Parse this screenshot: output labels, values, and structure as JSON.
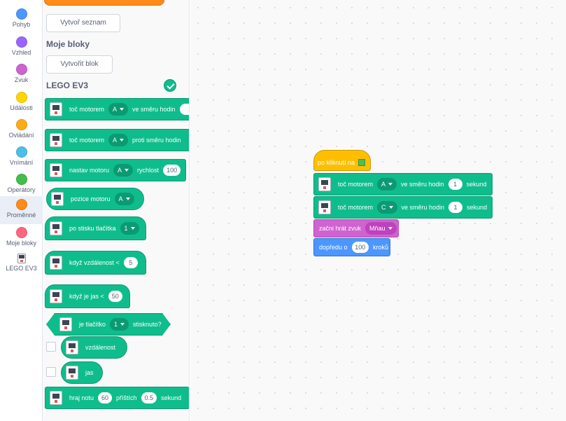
{
  "categories": [
    {
      "label": "Pohyb",
      "color": "#4c97ff",
      "icon": "motion-dot-icon"
    },
    {
      "label": "Vzhled",
      "color": "#9966ff",
      "icon": "looks-dot-icon"
    },
    {
      "label": "Zvuk",
      "color": "#cf63cf",
      "icon": "sound-dot-icon"
    },
    {
      "label": "Události",
      "color": "#ffd500",
      "icon": "events-dot-icon"
    },
    {
      "label": "Ovládání",
      "color": "#ffab19",
      "icon": "control-dot-icon"
    },
    {
      "label": "Vnímání",
      "color": "#4cbfe6",
      "icon": "sensing-dot-icon"
    },
    {
      "label": "Operátory",
      "color": "#40bf4a",
      "icon": "operators-dot-icon"
    },
    {
      "label": "Proměnné",
      "color": "#ff8c1a",
      "icon": "variables-dot-icon"
    },
    {
      "label": "Moje bloky",
      "color": "#ff6680",
      "icon": "myblocks-dot-icon"
    },
    {
      "label": "LEGO EV3",
      "color": "#0fbd8c",
      "icon": "ev3-brick-icon"
    }
  ],
  "palette": {
    "make_list": "Vytvoř seznam",
    "my_blocks_heading": "Moje bloky",
    "make_block": "Vytvořit blok",
    "ev3_heading": "LEGO EV3",
    "blocks": {
      "b1": {
        "t1": "toč motorem",
        "d1": "A",
        "t2": "ve směru hodin"
      },
      "b2": {
        "t1": "toč motorem",
        "d1": "A",
        "t2": "proti směru hodin"
      },
      "b3": {
        "t1": "nastav motoru",
        "d1": "A",
        "t2": "rychlost",
        "n1": "100"
      },
      "b4": {
        "t1": "pozice motoru",
        "d1": "A"
      },
      "b5": {
        "t1": "po stisku tlačítka",
        "d1": "1"
      },
      "b6": {
        "t1": "když vzdálenost <",
        "n1": "5"
      },
      "b7": {
        "t1": "když je jas <",
        "n1": "50"
      },
      "b8": {
        "t1": "je tlačítko",
        "d1": "1",
        "t2": "stisknuto?"
      },
      "b9": {
        "t1": "vzdálenost"
      },
      "b10": {
        "t1": "jas"
      },
      "b11": {
        "t1": "hraj notu",
        "n1": "60",
        "t2": "příštích",
        "n2": "0.5",
        "t3": "sekund"
      }
    }
  },
  "script": {
    "hat": "po kliknutí na",
    "s1": {
      "t1": "toč motorem",
      "d1": "A",
      "t2": "ve směru hodin",
      "n1": "1",
      "t3": "sekund"
    },
    "s2": {
      "t1": "toč motorem",
      "d1": "C",
      "t2": "ve směru hodin",
      "n1": "1",
      "t3": "sekund"
    },
    "sound": {
      "t1": "začni hrát zvuk",
      "d1": "Mňau"
    },
    "move": {
      "t1": "dopředu o",
      "n1": "100",
      "t2": "kroků"
    }
  }
}
